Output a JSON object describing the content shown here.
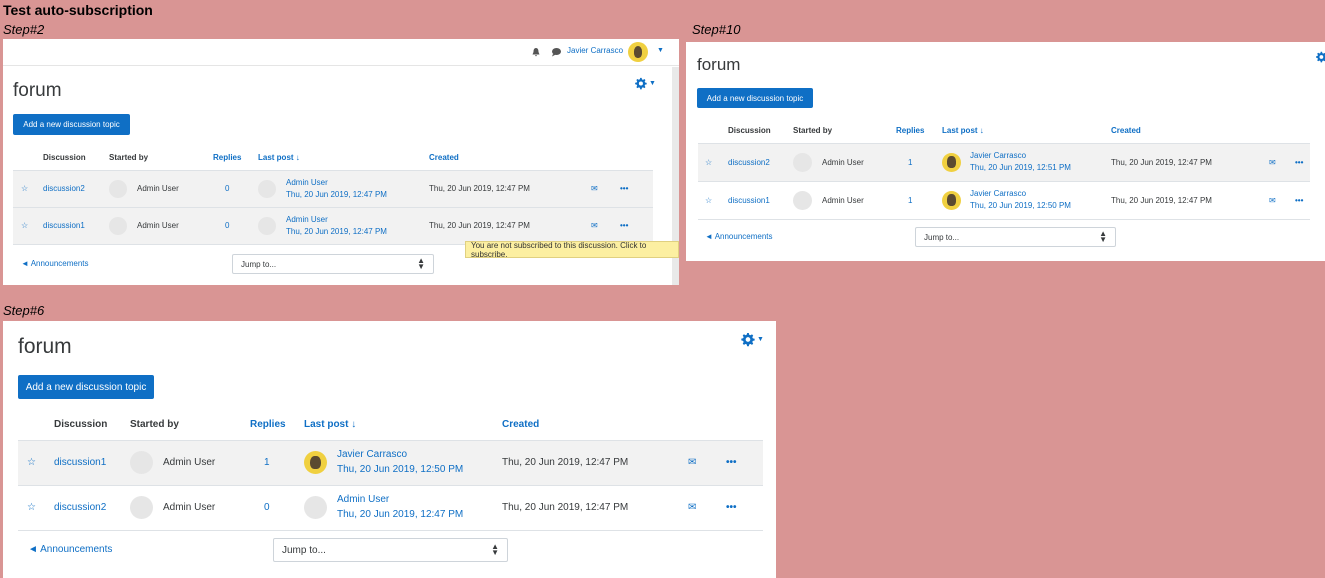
{
  "header": {
    "title": "Test auto-subscription"
  },
  "steps": {
    "step2": "Step#2",
    "step10": "Step#10",
    "step6": "Step#6"
  },
  "colors": {
    "background": "#d99594",
    "accent": "#0f6fc5",
    "tooltip": "#fcefa1"
  },
  "forum": {
    "title": "forum",
    "add_button": "Add a new discussion topic",
    "columns": {
      "discussion": "Discussion",
      "started_by": "Started by",
      "replies": "Replies",
      "last_post": "Last post",
      "created": "Created"
    },
    "sort_icon": "arrow-down-icon",
    "announcements": "◄ Announcements",
    "jump_to": "Jump to..."
  },
  "navbar": {
    "user_name": "Javier Carrasco",
    "icons": [
      "bell-icon",
      "chat-icon",
      "avatar",
      "chevron-down-icon"
    ]
  },
  "step2": {
    "tooltip": "You are not subscribed to this discussion. Click to subscribe.",
    "rows": [
      {
        "discussion": "discussion2",
        "started_by": "Admin User",
        "replies": "0",
        "last_author": "Admin User",
        "last_date": "Thu, 20 Jun 2019, 12:47 PM",
        "created": "Thu, 20 Jun 2019, 12:47 PM",
        "subscribed": false
      },
      {
        "discussion": "discussion1",
        "started_by": "Admin User",
        "replies": "0",
        "last_author": "Admin User",
        "last_date": "Thu, 20 Jun 2019, 12:47 PM",
        "created": "Thu, 20 Jun 2019, 12:47 PM",
        "subscribed": false
      }
    ]
  },
  "step10": {
    "rows": [
      {
        "discussion": "discussion2",
        "started_by": "Admin User",
        "replies": "1",
        "last_author": "Javier Carrasco",
        "last_date": "Thu, 20 Jun 2019, 12:51 PM",
        "created": "Thu, 20 Jun 2019, 12:47 PM",
        "subscribed": false
      },
      {
        "discussion": "discussion1",
        "started_by": "Admin User",
        "replies": "1",
        "last_author": "Javier Carrasco",
        "last_date": "Thu, 20 Jun 2019, 12:50 PM",
        "created": "Thu, 20 Jun 2019, 12:47 PM",
        "subscribed": true
      }
    ]
  },
  "step6": {
    "rows": [
      {
        "discussion": "discussion1",
        "started_by": "Admin User",
        "replies": "1",
        "last_author": "Javier Carrasco",
        "last_date": "Thu, 20 Jun 2019, 12:50 PM",
        "created": "Thu, 20 Jun 2019, 12:47 PM",
        "subscribed": true
      },
      {
        "discussion": "discussion2",
        "started_by": "Admin User",
        "replies": "0",
        "last_author": "Admin User",
        "last_date": "Thu, 20 Jun 2019, 12:47 PM",
        "created": "Thu, 20 Jun 2019, 12:47 PM",
        "subscribed": false
      }
    ]
  }
}
